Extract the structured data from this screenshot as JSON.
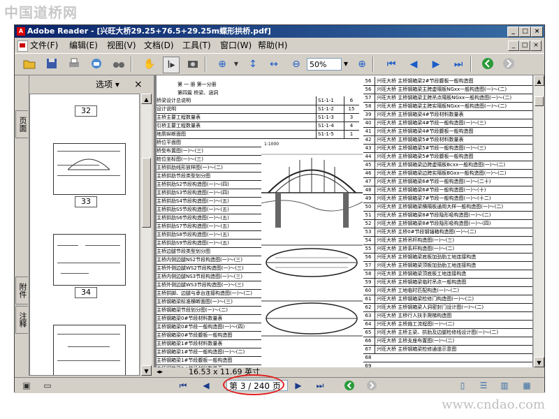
{
  "watermark_top": "中国道桥网",
  "watermark_bottom": "www.cndao.com",
  "window": {
    "title": "Adobe Reader - [兴旺大桥29.25+76.5+29.25m蝶形拱桥.pdf]",
    "controls": {
      "minimize": "_",
      "maximize": "□",
      "close": "×"
    }
  },
  "menu": [
    "文件(F)",
    "编辑(E)",
    "视图(V)",
    "文档(D)",
    "工具(T)",
    "窗口(W)",
    "帮助(H)"
  ],
  "toolbar": {
    "zoom_value": "50%",
    "icons": [
      "open-icon",
      "save-icon",
      "print-icon",
      "email-icon",
      "search-binoculars-icon",
      "hand-tool-icon",
      "select-text-icon",
      "snapshot-icon",
      "zoom-in-tool-icon",
      "fit-height-icon",
      "fit-width-icon",
      "zoom-out-icon",
      "zoom-in-icon",
      "first-page-icon",
      "prev-page-icon",
      "next-page-icon",
      "last-page-icon",
      "go-back-icon",
      "go-forward-icon"
    ]
  },
  "nav_pane": {
    "tabs": [
      "页面",
      "附件",
      "注释"
    ],
    "options_label": "选项 ▾",
    "close": "×",
    "thumbnails": [
      "32",
      "33",
      "34"
    ]
  },
  "document": {
    "header": {
      "line1": "第 一 册  第一分册",
      "line2": "第四篇  桥梁、涵洞"
    },
    "left_rows": [
      {
        "title": "桥梁设计总说明",
        "code": "S1-1-1",
        "pages": "6"
      },
      {
        "title": "设计说明",
        "code": "S1-1-2",
        "pages": "15"
      },
      {
        "title": "主桥主要工程数量表",
        "code": "S1-1-3",
        "pages": "3"
      },
      {
        "title": "引桥主要工程数量表",
        "code": "S1-1-4",
        "pages": "4"
      },
      {
        "title": "地质纵断面图",
        "code": "S1-1-5",
        "pages": "1"
      },
      {
        "title": "桥位平面图",
        "code": "",
        "pages": ""
      },
      {
        "title": "桥型布置图(一)～(三)",
        "code": "",
        "pages": ""
      },
      {
        "title": "桩位坐标图(一)～(三)",
        "code": "",
        "pages": ""
      },
      {
        "title": "主桥拱肋线形放样图(一)～(二)",
        "code": "",
        "pages": ""
      },
      {
        "title": "主桥拱肋节段类型划分图",
        "code": "",
        "pages": ""
      },
      {
        "title": "主桥拱肋S2节段构造图(一)～(四)",
        "code": "",
        "pages": ""
      },
      {
        "title": "主桥拱肋S3节段构造图(一)～(四)",
        "code": "",
        "pages": ""
      },
      {
        "title": "主桥拱肋S4节段构造图(一)～(五)",
        "code": "",
        "pages": ""
      },
      {
        "title": "主桥拱肋S5节段构造图(一)～(五)",
        "code": "",
        "pages": ""
      },
      {
        "title": "主桥拱肋S6节段构造图(一)～(五)",
        "code": "",
        "pages": ""
      },
      {
        "title": "主桥拱肋S7节段构造图(一)～(五)",
        "code": "",
        "pages": ""
      },
      {
        "title": "主桥拱肋S8节段构造图(一)～(五)",
        "code": "",
        "pages": ""
      },
      {
        "title": "主桥拱肋S9节段构造图(一)～(五)",
        "code": "",
        "pages": ""
      },
      {
        "title": "主桥边腿节段类型划分图",
        "code": "",
        "pages": ""
      },
      {
        "title": "主桥内侧边腿NS2节段构造图(一)～(三)",
        "code": "",
        "pages": ""
      },
      {
        "title": "主桥外侧边腿WS2节段构造图(一)～(三)",
        "code": "",
        "pages": ""
      },
      {
        "title": "主桥内侧边腿NS3节段构造图(一)～(三)",
        "code": "",
        "pages": ""
      },
      {
        "title": "主桥外侧边腿WS3节段构造图(一)～(三)",
        "code": "",
        "pages": ""
      },
      {
        "title": "主桥拱脚、边腿与承台连接构造图(一)～(二)",
        "code": "",
        "pages": ""
      },
      {
        "title": "主桥钢箱梁标准横断面图(一)～(三)",
        "code": "",
        "pages": ""
      },
      {
        "title": "主桥钢箱梁节段划分图(一)～(二)",
        "code": "S1-1-26",
        "pages": "3"
      },
      {
        "title": "主桥钢箱梁0#节段材料数量表",
        "code": "S1-1-27",
        "pages": "1"
      },
      {
        "title": "主桥钢箱梁0#节段一般构造图(一)～(四)",
        "code": "S1-1-28",
        "pages": "3"
      },
      {
        "title": "主桥钢箱梁0#节段腹板一般构造图",
        "code": "S1-1-29",
        "pages": "1"
      },
      {
        "title": "主桥钢箱梁1#节段材料数量表",
        "code": "S1-1-30",
        "pages": "1"
      },
      {
        "title": "主桥钢箱梁1#节段一般构造图(一)～(二)",
        "code": "S1-1-31",
        "pages": "3"
      },
      {
        "title": "主桥钢箱梁1#节段腹板一般构造图",
        "code": "S1-1-32",
        "pages": "1"
      },
      {
        "title": "主桥钢箱梁2#节段材料数量表",
        "code": "S1-1-33",
        "pages": "1"
      }
    ],
    "right_rows": [
      {
        "no": "56",
        "title": "兴旺大桥 主桥钢箱梁2#节段腹板一般构造图"
      },
      {
        "no": "56",
        "title": "兴旺大桥 主桥钢箱梁主跨虚隔板NGxx一般构造图(一)～(二)"
      },
      {
        "no": "57",
        "title": "兴旺大桥 主桥钢箱梁主跨吊点隔板NGxx一般构造图(一)～(二)"
      },
      {
        "no": "58",
        "title": "兴旺大桥 主桥钢箱梁主跨实隔板NGxx一般构造图(一)～(二)"
      },
      {
        "no": "39",
        "title": "兴旺大桥 主桥钢箱梁4#节段材料数量表"
      },
      {
        "no": "40",
        "title": "兴旺大桥 主桥钢箱梁4#节段一般构造图(一)～(三)"
      },
      {
        "no": "41",
        "title": "兴旺大桥 主桥钢箱梁4#节段腹板一般构造图"
      },
      {
        "no": "42",
        "title": "兴旺大桥 主桥钢箱梁5#节段材料数量表"
      },
      {
        "no": "43",
        "title": "兴旺大桥 主桥钢箱梁5#节段一般构造图(一)～(三)"
      },
      {
        "no": "44",
        "title": "兴旺大桥 主桥钢箱梁5#节段腹板一般构造图"
      },
      {
        "no": "45",
        "title": "兴旺大桥 主桥钢箱梁边跨虚隔板Bcxx一般构造图(一)～(二)"
      },
      {
        "no": "46",
        "title": "兴旺大桥 主桥钢箱梁边跨实隔板BGxx一般构造图(一)～(二)"
      },
      {
        "no": "47",
        "title": "兴旺大桥 主桥钢箱梁6#节段一般构造图(一)～(二十)"
      },
      {
        "no": "48",
        "title": "兴旺大桥 主桥钢箱梁6#节段一般构造图(一)～(十)"
      },
      {
        "no": "49",
        "title": "兴旺大桥 主桥钢箱梁7#节段一般构造图(一)～(十二)"
      },
      {
        "no": "50",
        "title": "兴旺大桥 主桥钢箱梁横隔板通用大样一般构造图(一)～(二)"
      },
      {
        "no": "51",
        "title": "兴旺大桥 主桥钢箱梁8#节段隐形吸构造图(一)～(二)"
      },
      {
        "no": "52",
        "title": "兴旺大桥 主桥钢箱梁8#节段隐形吸构造图(一)～(四)"
      },
      {
        "no": "53",
        "title": "兴旺大桥 主桥0#节段钢锚箱构造图(一)～(二)"
      },
      {
        "no": "54",
        "title": "兴旺大桥 主桥吊杆构造图(一)～(三)"
      },
      {
        "no": "55",
        "title": "兴旺大桥 主桥系杆构造图(一)～(二)"
      },
      {
        "no": "56",
        "title": "兴旺大桥 主桥钢箱梁底板加劲肋工地连接构造"
      },
      {
        "no": "57",
        "title": "兴旺大桥 主桥钢箱梁顶板加劲肋工地连接构造"
      },
      {
        "no": "58",
        "title": "兴旺大桥 主桥钢箱梁顶底板工地连接构造"
      },
      {
        "no": "59",
        "title": "兴旺大桥 主桥钢箱梁临时吊点一般构造图"
      },
      {
        "no": "60",
        "title": "兴旺大桥 工地临时匹配构造(一)～(二)"
      },
      {
        "no": "61",
        "title": "兴旺大桥 主桥钢箱梁检修门构造图(一)～(二)"
      },
      {
        "no": "62",
        "title": "兴旺大桥 主桥钢箱梁人洞密封门设计图(一)～(二)"
      },
      {
        "no": "63",
        "title": "兴旺大桥 主桥行人扶手爬梯构造图"
      },
      {
        "no": "64",
        "title": "兴旺大桥 主桥施工流程图(一)～(二)"
      },
      {
        "no": "65",
        "title": "兴旺大桥 主桥主梁、拱肋及边腿检修线设计图(一)～(二)"
      },
      {
        "no": "66",
        "title": "兴旺大桥 主桥支座布置图(一)～(二)"
      },
      {
        "no": "67",
        "title": "兴旺大桥 主桥钢箱梁检修通道示意图"
      },
      {
        "no": "68",
        "title": ""
      },
      {
        "no": "69",
        "title": ""
      }
    ],
    "overlay_scale": "1:1000"
  },
  "page_size_label": "16.53 x 11.69 英寸",
  "status": {
    "page_indicator": "第 3 / 240 页"
  }
}
